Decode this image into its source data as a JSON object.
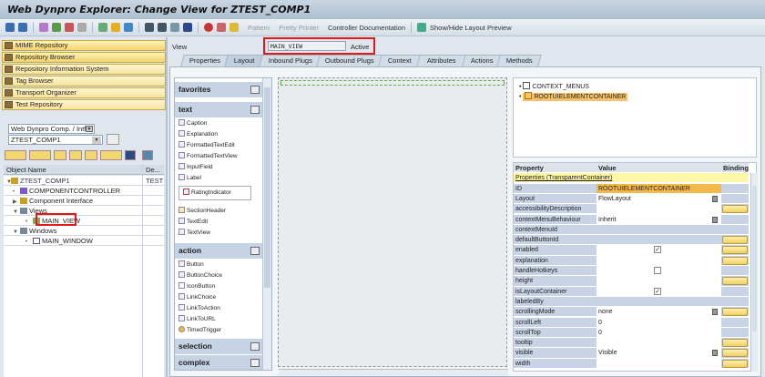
{
  "title": "Web Dynpro Explorer: Change View for ZTEST_COMP1",
  "toolbar": {
    "pattern": "Pattern",
    "pretty_printer": "Pretty Printer",
    "controller_doc": "Controller Documentation",
    "show_hide": "Show/Hide Layout Preview"
  },
  "left": {
    "nav": [
      "MIME Repository",
      "Repository Browser",
      "Repository Information System",
      "Tag Browser",
      "Transport Organizer",
      "Test Repository"
    ],
    "object_type": "Web Dynpro Comp. / Intf.",
    "object_name": "ZTEST_COMP1",
    "tree_headers": [
      "Object Name",
      "De..."
    ],
    "tree": [
      {
        "label": "ZTEST_COMP1",
        "desc": "TEST C"
      },
      {
        "label": "COMPONENTCONTROLLER"
      },
      {
        "label": "Component Interface"
      },
      {
        "label": "Views"
      },
      {
        "label": "MAIN_VIEW"
      },
      {
        "label": "Windows"
      },
      {
        "label": "MAIN_WINDOW"
      }
    ]
  },
  "view": {
    "label": "View",
    "name": "MAIN_VIEW",
    "status": "Active"
  },
  "tabs": [
    "Properties",
    "Layout",
    "Inbound Plugs",
    "Outbound Plugs",
    "Context",
    "Attributes",
    "Actions",
    "Methods"
  ],
  "palette": {
    "groups": [
      "favorites",
      "text",
      "action",
      "selection",
      "complex"
    ],
    "text_items": [
      "Caption",
      "Explanation",
      "FormattedTextEdit",
      "FormattedTextView",
      "InputField",
      "Label",
      "RatingIndicator",
      "SectionHeader",
      "TextEdit",
      "TextView"
    ],
    "action_items": [
      "Button",
      "ButtonChoice",
      "IconButton",
      "LinkChoice",
      "LinkToAction",
      "LinkToURL",
      "TimedTrigger"
    ]
  },
  "outline": [
    "CONTEXT_MENUS",
    "ROOTUIELEMENTCONTAINER"
  ],
  "props": {
    "headers": [
      "Property",
      "Value",
      "Binding"
    ],
    "section": "Properties (TransparentContainer)",
    "rows": [
      {
        "p": "ID",
        "v": "ROOTUIELEMENTCONTAINER"
      },
      {
        "p": "Layout",
        "v": "FlowLayout"
      },
      {
        "p": "accessibilityDescription",
        "v": ""
      },
      {
        "p": "contextMenuBehaviour",
        "v": "Inherit"
      },
      {
        "p": "contextMenuId",
        "v": ""
      },
      {
        "p": "defaultButtonId",
        "v": ""
      },
      {
        "p": "enabled",
        "v": ""
      },
      {
        "p": "explanation",
        "v": ""
      },
      {
        "p": "handleHotkeys",
        "v": ""
      },
      {
        "p": "height",
        "v": ""
      },
      {
        "p": "isLayoutContainer",
        "v": ""
      },
      {
        "p": "labeledBy",
        "v": ""
      },
      {
        "p": "scrollingMode",
        "v": "none"
      },
      {
        "p": "scrollLeft",
        "v": "0"
      },
      {
        "p": "scrollTop",
        "v": "0"
      },
      {
        "p": "tooltip",
        "v": ""
      },
      {
        "p": "visible",
        "v": "Visible"
      },
      {
        "p": "width",
        "v": ""
      }
    ]
  }
}
